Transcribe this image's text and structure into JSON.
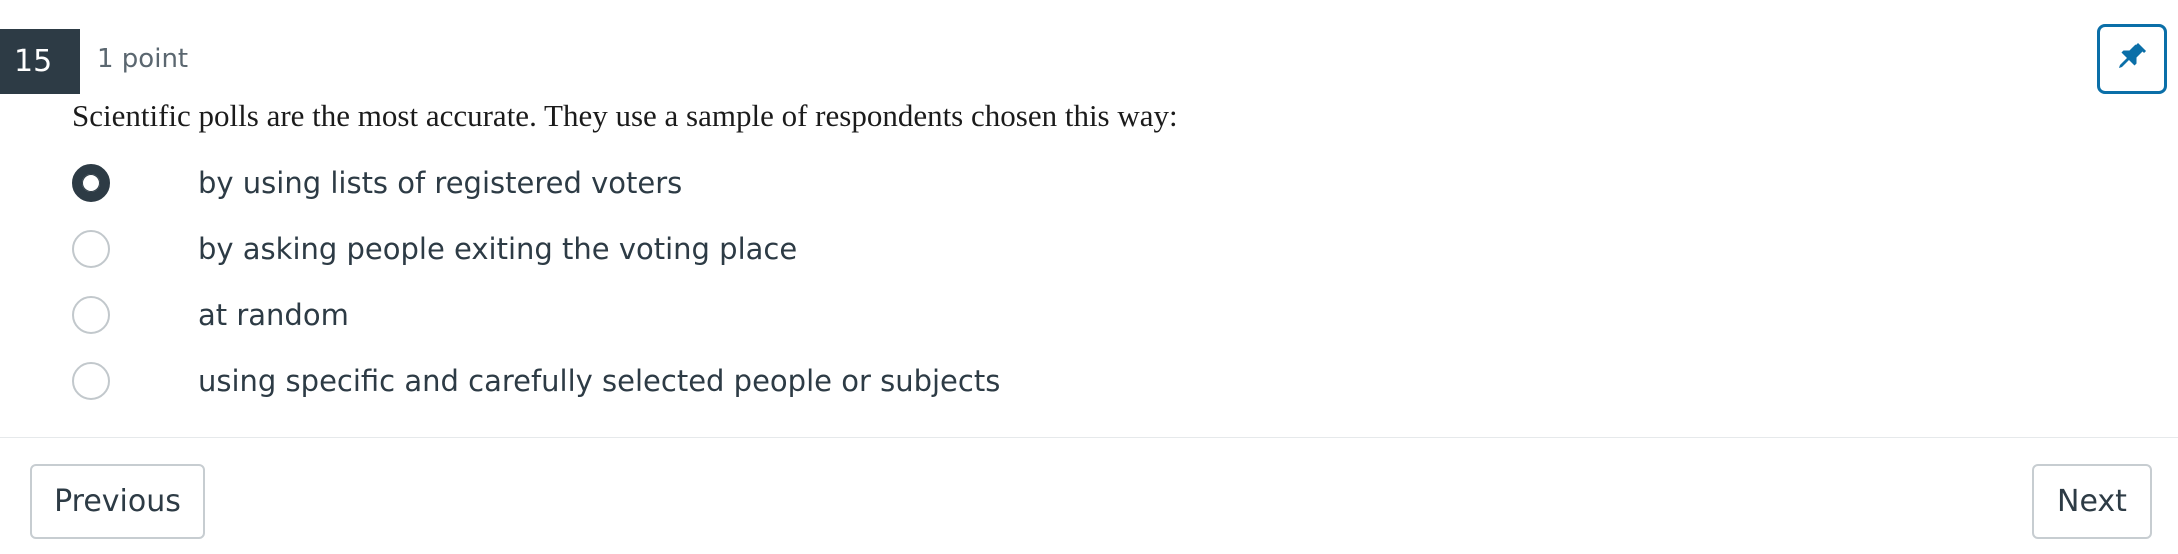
{
  "question": {
    "number": "15",
    "points": "1 point",
    "text": "Scientific polls are the most accurate. They use a sample of respondents chosen this way:",
    "answers": [
      {
        "label": "by using lists of registered voters",
        "selected": true
      },
      {
        "label": "by asking people exiting the voting place",
        "selected": false
      },
      {
        "label": "at random",
        "selected": false
      },
      {
        "label": "using specific and carefully selected people or subjects",
        "selected": false
      }
    ]
  },
  "toolbar": {
    "pin_icon": "pin-icon"
  },
  "navigation": {
    "previous_label": "Previous",
    "next_label": "Next"
  },
  "colors": {
    "header_bg": "#2d3b45",
    "accent": "#0b6fa8",
    "border": "#c7cdd1"
  }
}
